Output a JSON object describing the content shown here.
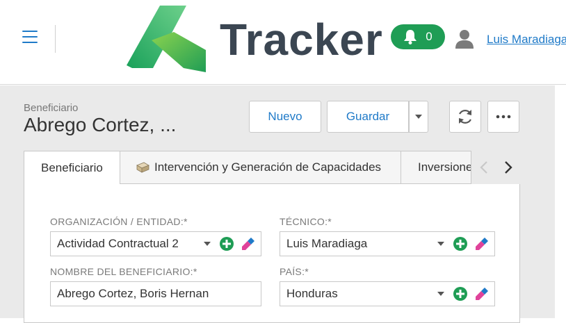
{
  "header": {
    "brand": "Tracker",
    "notifications_count": "0",
    "user_name": "Luis Maradiaga",
    "icons": [
      "menu-icon",
      "bell-icon",
      "user-icon"
    ]
  },
  "record": {
    "entity_type": "Beneficiario",
    "entity_name": "Abrego Cortez, ..."
  },
  "toolbar": {
    "new_label": "Nuevo",
    "save_label": "Guardar",
    "icons": [
      "caret-down-icon",
      "refresh-icon",
      "more-icon"
    ]
  },
  "tabs": [
    {
      "label": "Beneficiario",
      "active": true
    },
    {
      "label": "Intervención y Generación de Capacidades",
      "icon": "package-icon"
    },
    {
      "label": "Inversione"
    }
  ],
  "form": {
    "organizacion": {
      "label": "ORGANIZACIÓN / ENTIDAD:*",
      "value": "Actividad Contractual 2"
    },
    "tecnico": {
      "label": "TÉCNICO:*",
      "value": "Luis Maradiaga"
    },
    "nombre": {
      "label": "NOMBRE DEL BENEFICIARIO:*",
      "value": "Abrego Cortez, Boris Hernan"
    },
    "pais": {
      "label": "PAÍS:*",
      "value": "Honduras"
    }
  },
  "colors": {
    "accent": "#1f7ac8",
    "success": "#1f9d55",
    "brand_text": "#3b4652",
    "eraser": "#e0439a"
  }
}
